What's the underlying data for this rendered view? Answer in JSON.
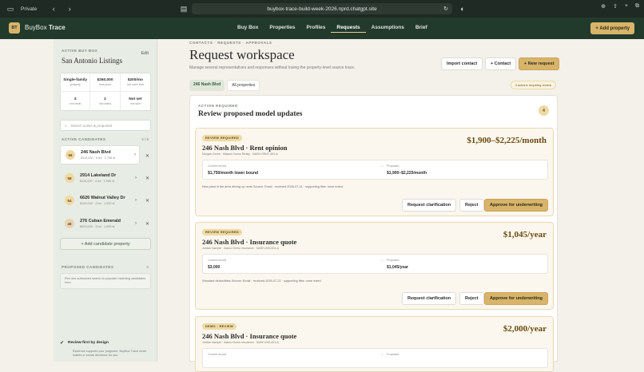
{
  "browser": {
    "private_label": "Private",
    "url": "buybox-trace-build-week-2026.nprd.chatgpt.site"
  },
  "app": {
    "logo": "BT",
    "brand_a": "BuyBox",
    "brand_b": "Trace",
    "add_property": "+ Add property"
  },
  "nav": [
    "Buy Box",
    "Properties",
    "Profiles",
    "Requests",
    "Assumptions",
    "Brief"
  ],
  "sidebar": {
    "active_label": "ACTIVE BUY BOX",
    "edit": "Edit",
    "name": "San Antonio Listings",
    "stats": [
      {
        "v": "Single-family",
        "k": "property"
      },
      {
        "v": "$260,000",
        "k": "max price"
      },
      {
        "v": "$200/mo",
        "k": "min cash flow"
      },
      {
        "v": "3",
        "k": "min beds"
      },
      {
        "v": "2",
        "k": "min baths"
      },
      {
        "v": "Not set",
        "k": "min size"
      }
    ],
    "search_placeholder": "Search active & proposed",
    "candidates_label": "ACTIVE CANDIDATES",
    "candidates_count": "4 / 5",
    "candidates": [
      {
        "score": "56",
        "name": "246 Nash Blvd",
        "detail": "$110,000 · 3 bd · 1,798 sf"
      },
      {
        "score": "58",
        "name": "2914 Lakeland Dr",
        "detail": "$115,000 · 4 bd · 1,550 sf"
      },
      {
        "score": "54",
        "name": "6626 Walnut Valley Dr",
        "detail": "$149,000 · 4 bd · 1,920 sf"
      },
      {
        "score": "48",
        "name": "276 Cuban Emerald",
        "detail": "$229,000 · 3 bd · 1,653 sf"
      }
    ],
    "add_candidate": "+ Add candidate property",
    "proposed_label": "PROPOSED CANDIDATES",
    "proposed_count": "0",
    "proposed_text": "Run one authorized search to populate matching candidates here.",
    "review_title": "Review-first by design",
    "review_text": "Evidence supports your judgment. BuyBox Trace never makes or sends decisions for you."
  },
  "main": {
    "crumb": "CONTACTS · REQUESTS · APPROVALS",
    "title": "Request workspace",
    "subtitle": "Manage several representatives and responses without losing the property-level source trace.",
    "import": "Import contact",
    "contact": "+ Contact",
    "new_request": "+ New request",
    "tab_on": "246 Nash Blvd",
    "tab_off": "All properties",
    "actions_badge": "4 actions requiring review",
    "panel_label": "ACTION REQUIRED",
    "panel_title": "Review proposed model updates",
    "panel_count": "4"
  },
  "cards": [
    {
      "badge": "REVIEW REQUIRED",
      "title": "246 Nash Blvd · Rent opinion",
      "meta": "Morgan Demo · Mission Demo Realty · NASH-RENT-001-A",
      "amount": "$1,900–$2,225/month",
      "current_label": "Current record",
      "current": "$1,750/month lower bound",
      "proposed_label": "Proposed",
      "proposed": "$1,900–$2,225/month",
      "note": "New plant in the area driving up rents Source: Email · received 2026-07-21 · supporting files: none noted",
      "clarify": "Request clarification",
      "reject": "Reject",
      "approve": "Approve for underwriting"
    },
    {
      "badge": "REVIEW REQUIRED",
      "title": "246 Nash Blvd · Insurance quote",
      "meta": "Jordan Sample · Alamo Demo Insurance · NASH-INS-001-A",
      "amount": "$1,045/year",
      "current_label": "Current record",
      "current": "$3,000",
      "proposed_label": "Proposed",
      "proposed": "$1,045/year",
      "note": "Standard deductibles Source: Email · received 2026-07-21 · supporting files: none noted",
      "clarify": "Request clarification",
      "reject": "Reject",
      "approve": "Approve for underwriting"
    },
    {
      "badge": "DEMO · REVIEW",
      "title": "246 Nash Blvd · Insurance quote",
      "meta": "Jordan Sample · Alamo Demo Insurance · NASH-INS-001-A",
      "amount": "$2,000/year",
      "current_label": "Current record",
      "proposed_label": "Proposed"
    }
  ]
}
